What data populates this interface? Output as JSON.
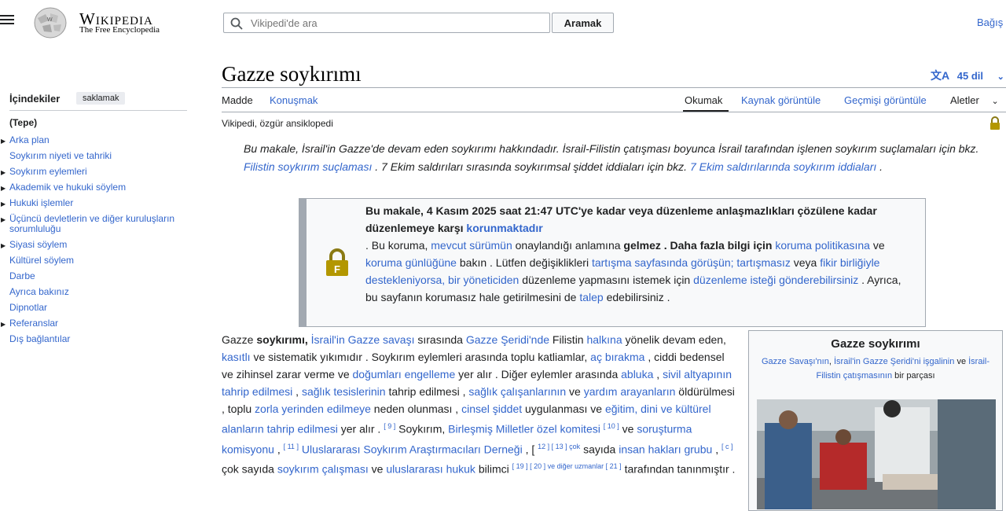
{
  "header": {
    "logo_wordmark": "Wikipedia",
    "logo_tagline": "The Free Encyclopedia",
    "search_placeholder": "Vikipedi'de ara",
    "search_button": "Aramak",
    "donate": "Bağış"
  },
  "toc": {
    "title": "İçindekiler",
    "hide": "saklamak",
    "items": [
      {
        "label": "(Tepe)",
        "expandable": false
      },
      {
        "label": "Arka plan",
        "expandable": true
      },
      {
        "label": "Soykırım niyeti ve tahriki",
        "expandable": false
      },
      {
        "label": "Soykırım eylemleri",
        "expandable": true
      },
      {
        "label": "Akademik ve hukuki söylem",
        "expandable": true
      },
      {
        "label": "Hukuki işlemler",
        "expandable": true
      },
      {
        "label": "Üçüncü devletlerin ve diğer kuruluşların sorumluluğu",
        "expandable": true
      },
      {
        "label": "Siyasi söylem",
        "expandable": true
      },
      {
        "label": "Kültürel söylem",
        "expandable": false
      },
      {
        "label": "Darbe",
        "expandable": false
      },
      {
        "label": "Ayrıca bakınız",
        "expandable": false
      },
      {
        "label": "Dipnotlar",
        "expandable": false
      },
      {
        "label": "Referanslar",
        "expandable": true
      },
      {
        "label": "Dış bağlantılar",
        "expandable": false
      }
    ]
  },
  "article": {
    "title": "Gazze soykırımı",
    "languages": "45 dil",
    "tabs": {
      "article": "Madde",
      "talk": "Konuşmak",
      "read": "Okumak",
      "source": "Kaynak görüntüle",
      "history": "Geçmişi görüntüle",
      "tools": "Aletler"
    },
    "tagline": "Vikipedi, özgür ansiklopedi",
    "hatnote": {
      "t1": "Bu makale, İsrail'in Gazze'de devam eden soykırımı hakkındadır. İsrail-Filistin çatışması boyunca İsrail tarafından işlenen soykırım suçlamaları için bkz.",
      "l1": "Filistin soykırım suçlaması",
      "t2": ". 7 Ekim saldırıları sırasında soykırımsal şiddet iddiaları için bkz.",
      "l2": "7 Ekim saldırılarında soykırım iddiaları",
      "t3": "."
    },
    "protection": {
      "bold1": "Bu makale, 4 Kasım 2025 saat 21:47 UTC'ye kadar veya düzenleme anlaşmazlıkları çözülene kadar düzenlemeye karşı",
      "link_protected": "korunmaktadır",
      "t1": ". Bu koruma,",
      "link_current": "mevcut sürümün",
      "t2": "onaylandığı anlamına",
      "bold2": "gelmez . Daha fazla bilgi için",
      "link_policy": "koruma politikasına",
      "t3": "ve",
      "link_log": "koruma günlüğüne",
      "t4": "bakın . Lütfen değişiklikleri",
      "link_talk": "tartışma sayfasında görüşün;",
      "link_undiscussed": "tartışmasız",
      "t5": "veya",
      "link_consensus": "fikir birliğiyle destekleniyorsa, bir yöneticiden",
      "t6": "düzenleme yapmasını istemek için",
      "link_request": "düzenleme isteği gönderebilirsiniz",
      "t7": ". Ayrıca, bu sayfanın korumasız hale getirilmesini de",
      "link_unprotect": "talep",
      "t8": "edebilirsiniz ."
    },
    "lead": {
      "p1": "Gazze",
      "p1b": "soykırımı,",
      "l1": "İsrail'in Gazze savaşı",
      "p2": "sırasında",
      "l2": "Gazze Şeridi'nde",
      "p3": "Filistin",
      "l3": "halkına",
      "p4": "yönelik devam eden,",
      "l4": "kasıtlı",
      "p5": "ve sistematik yıkımıdır . Soykırım eylemleri arasında toplu katliamlar,",
      "l5": "aç bırakma",
      "p6": ", ciddi bedensel ve zihinsel zarar verme ve",
      "l6": "doğumları engelleme",
      "p7": "yer alır . Diğer eylemler arasında",
      "l7": "abluka",
      "p8": ",",
      "l8": "sivil altyapının tahrip edilmesi",
      "p9": ",",
      "l9": "sağlık tesislerinin",
      "p10": "tahrip edilmesi ,",
      "l10": "sağlık çalışanlarının",
      "p11": "ve",
      "l11": "yardım arayanların",
      "p12": "öldürülmesi , toplu",
      "l12": "zorla yerinden edilmeye",
      "p13": "neden olunması ,",
      "l13": "cinsel şiddet",
      "p14": "uygulanması ve",
      "l14": "eğitim, dini ve kültürel alanların tahrip edilmesi",
      "p15": "yer alır .",
      "r1": "[ 9 ]",
      "p16": "Soykırım,",
      "l15": "Birleşmiş Milletler özel komitesi",
      "r2": "[ 10 ]",
      "p17": "ve",
      "l16": "soruşturma komisyonu",
      "p18": ",",
      "r3": "[ 11 ]",
      "l17": "Uluslararası Soykırım Araştırmacıları Derneği",
      "p19": ", [",
      "r4": "12 ] [ 13 ] çok",
      "p20": "sayıda",
      "l18": "insan hakları grubu",
      "p21": ",",
      "r5": "[ c ]",
      "p22": "çok sayıda",
      "l19": "soykırım çalışması",
      "p23": "ve",
      "l20": "uluslararası hukuk",
      "p24": "bilimci",
      "r6": "[ 19 ] [ 20 ] ve diğer uzmanlar [ 21 ]",
      "p25": "tarafından tanınmıştır ."
    },
    "infobox": {
      "title": "Gazze soykırımı",
      "l1": "Gazze Savaşı'nın",
      "t1": ",",
      "l2": "İsrail'in Gazze Şeridi'ni işgalinin",
      "t2": "ve",
      "l3": "İsrail-Filistin çatışmasının",
      "t3": "bir parçası"
    }
  }
}
